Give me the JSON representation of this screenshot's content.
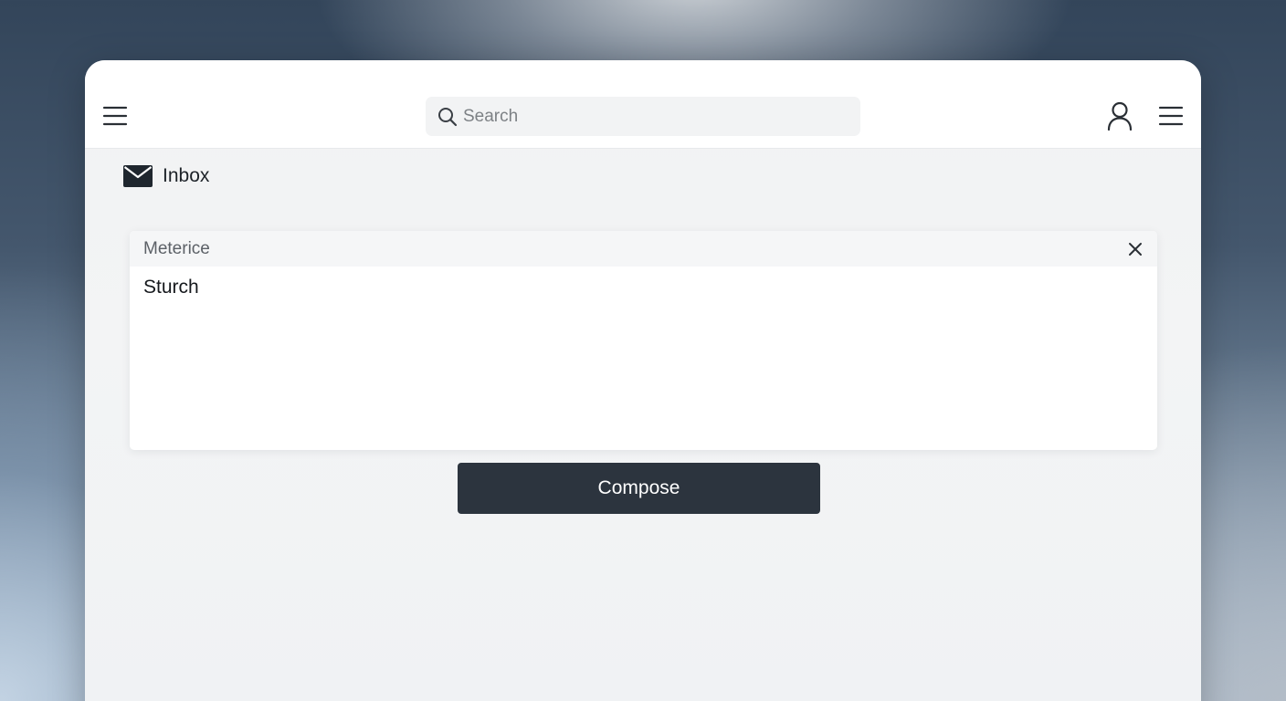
{
  "header": {
    "search_placeholder": "Search",
    "icons": {
      "menu_left": "hamburger-menu-icon",
      "search": "search-icon",
      "user": "user-icon",
      "menu_right": "hamburger-menu-icon"
    }
  },
  "nav": {
    "inbox_label": "Inbox",
    "inbox_icon": "envelope-icon"
  },
  "compose_card": {
    "subject": "Meterice",
    "body": "Sturch",
    "close_icon": "close-icon"
  },
  "actions": {
    "compose_label": "Compose"
  },
  "colors": {
    "header_bg": "#ffffff",
    "window_bg": "#f2f3f4",
    "primary_button": "#2c343e",
    "icon_color": "#1d2228"
  }
}
